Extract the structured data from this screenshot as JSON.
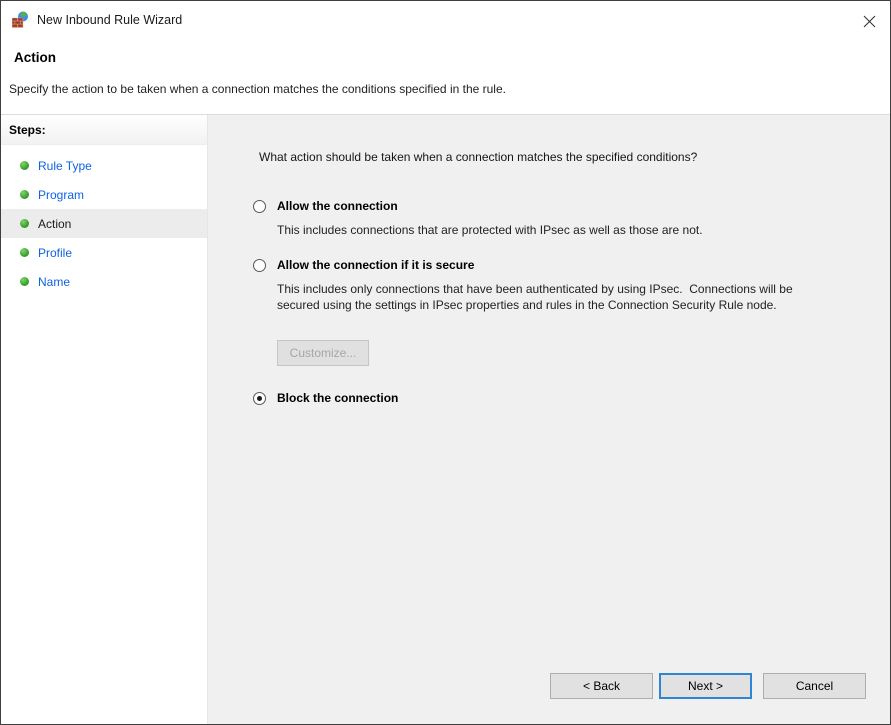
{
  "window": {
    "title": "New Inbound Rule Wizard"
  },
  "header": {
    "title": "Action",
    "subtitle": "Specify the action to be taken when a connection matches the conditions specified in the rule."
  },
  "sidebar": {
    "heading": "Steps:",
    "steps": [
      {
        "label": "Rule Type",
        "state": "link"
      },
      {
        "label": "Program",
        "state": "link"
      },
      {
        "label": "Action",
        "state": "current"
      },
      {
        "label": "Profile",
        "state": "link"
      },
      {
        "label": "Name",
        "state": "link"
      }
    ]
  },
  "main": {
    "question": "What action should be taken when a connection matches the specified conditions?",
    "options": [
      {
        "label": "Allow the connection",
        "description": "This includes connections that are protected with IPsec as well as those are not.",
        "selected": false
      },
      {
        "label": "Allow the connection if it is secure",
        "description": "This includes only connections that have been authenticated by using IPsec.  Connections will be secured using the settings in IPsec properties and rules in the Connection Security Rule node.",
        "selected": false,
        "customize_label": "Customize..."
      },
      {
        "label": "Block the connection",
        "description": "",
        "selected": true
      }
    ]
  },
  "footer": {
    "back_label": "< Back",
    "next_label": "Next >",
    "cancel_label": "Cancel"
  },
  "icons": {
    "app_icon": "firewall-icon",
    "close": "close-icon"
  },
  "colors": {
    "link": "#0f62e6",
    "bullet": "#3aa22e",
    "accent": "#2e86d3",
    "content_bg": "#f0f0f0"
  }
}
